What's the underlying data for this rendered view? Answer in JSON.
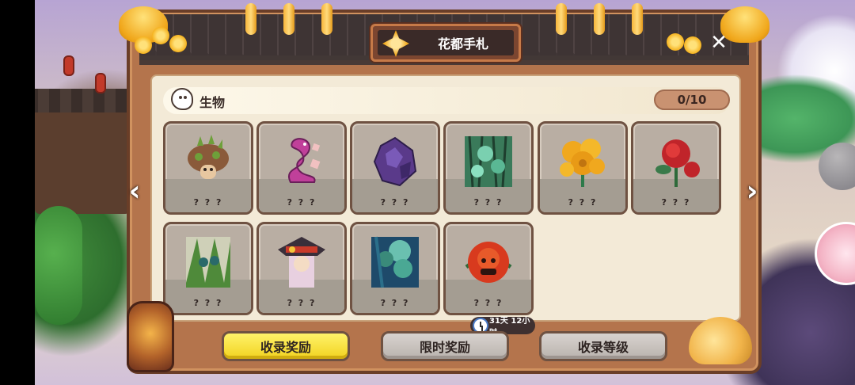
{
  "header": {
    "title": "花都手札",
    "close_icon": "close-icon"
  },
  "section": {
    "title": "生物",
    "count": "0/10"
  },
  "collection": {
    "items": [
      {
        "label": "? ? ?",
        "icon": "spiked-mushroom-icon",
        "color": "#8b5a3a"
      },
      {
        "label": "? ? ?",
        "icon": "pink-serpent-icon",
        "color": "#c0409a"
      },
      {
        "label": "? ? ?",
        "icon": "purple-crystal-beast-icon",
        "color": "#5a3a8a"
      },
      {
        "label": "? ? ?",
        "icon": "green-vine-crystal-icon",
        "color": "#3fa27a"
      },
      {
        "label": "? ? ?",
        "icon": "yellow-flower-icon",
        "color": "#f0a81e"
      },
      {
        "label": "? ? ?",
        "icon": "red-flower-icon",
        "color": "#c0242a"
      },
      {
        "label": "? ? ?",
        "icon": "green-vine-beast-icon",
        "color": "#4f8a3a"
      },
      {
        "label": "? ? ?",
        "icon": "hat-girl-icon",
        "color": "#3a2f3a"
      },
      {
        "label": "? ? ?",
        "icon": "teal-vine-icon",
        "color": "#2b6f8a"
      },
      {
        "label": "? ? ?",
        "icon": "red-rose-beast-icon",
        "color": "#d83a1e"
      }
    ]
  },
  "navigation": {
    "prev_icon": "chevron-left-icon",
    "next_icon": "chevron-right-icon"
  },
  "timer": {
    "text": "31天 12小时"
  },
  "buttons": {
    "collection_reward": "收录奖励",
    "limited_reward": "限时奖励",
    "collection_level": "收录等级"
  },
  "colors": {
    "accent_yellow": "#f5dc2a",
    "panel_bg": "#f3ead7",
    "frame_brown": "#b4744c"
  }
}
